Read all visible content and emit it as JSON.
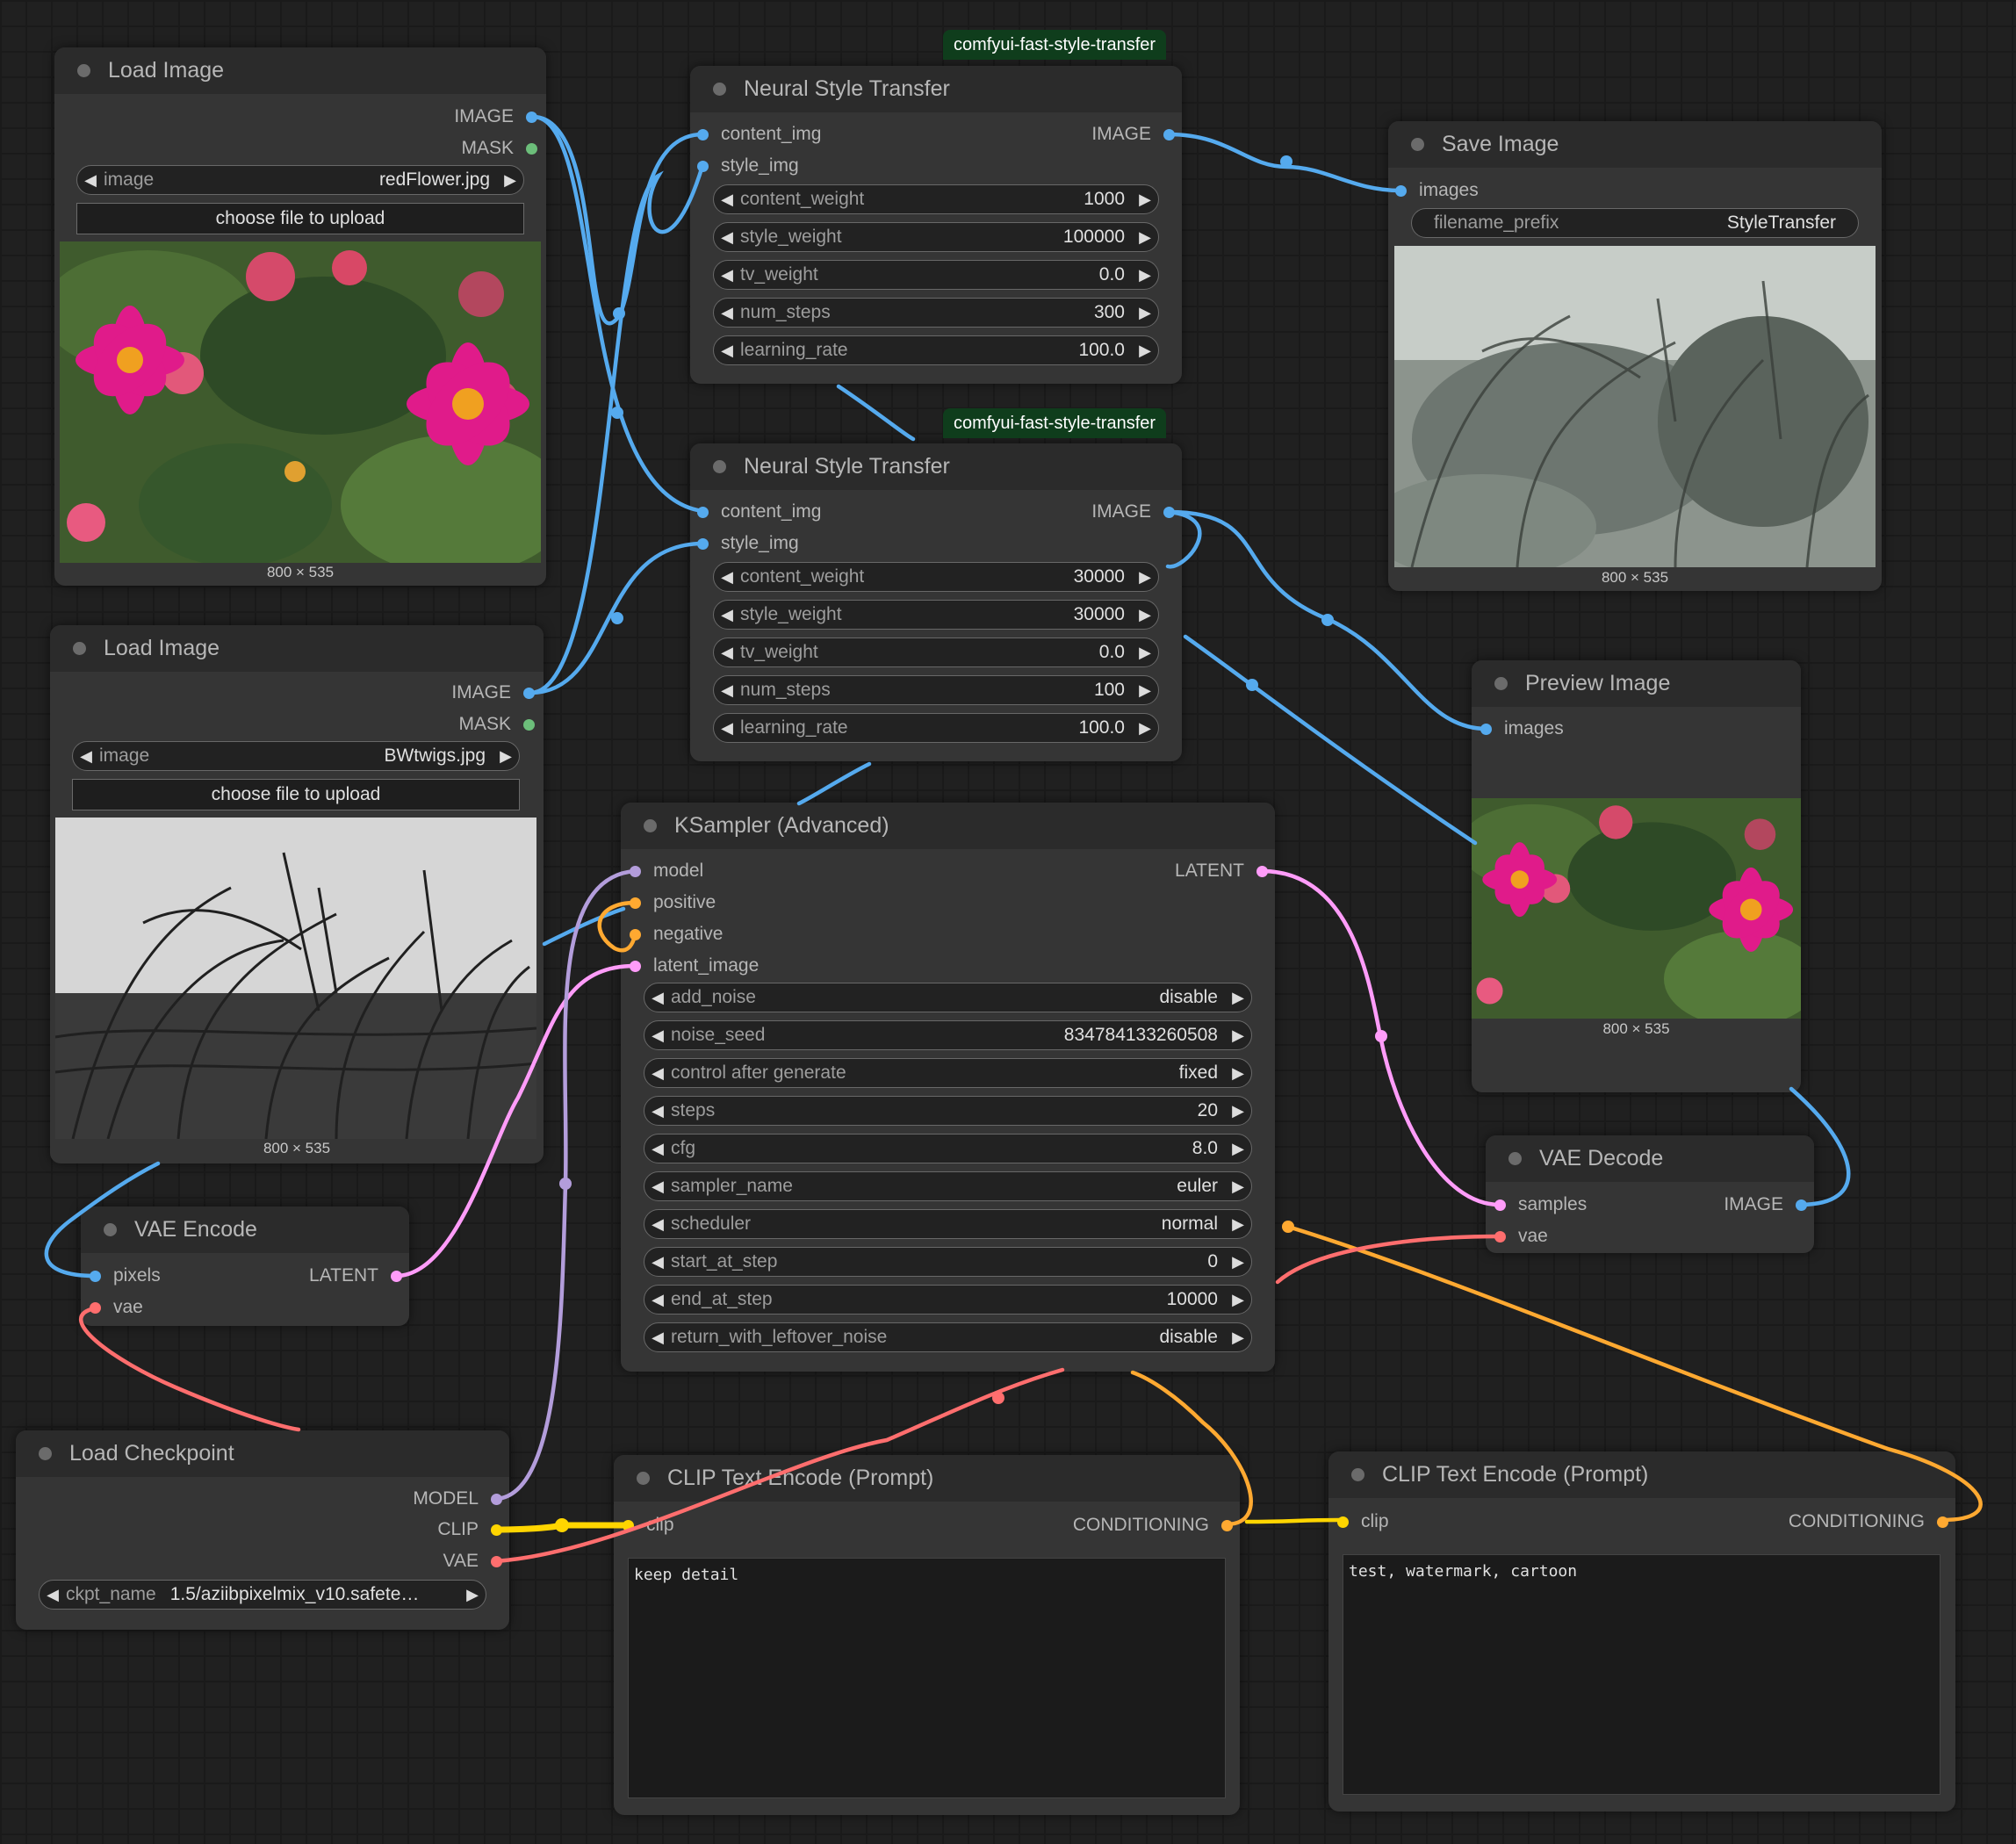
{
  "badges": {
    "nst1": "comfyui-fast-style-transfer",
    "nst2": "comfyui-fast-style-transfer"
  },
  "load_image_1": {
    "title": "Load Image",
    "out_image": "IMAGE",
    "out_mask": "MASK",
    "widget_label": "image",
    "widget_value": "redFlower.jpg",
    "upload_label": "choose file to upload",
    "dims": "800 × 535"
  },
  "load_image_2": {
    "title": "Load Image",
    "out_image": "IMAGE",
    "out_mask": "MASK",
    "widget_label": "image",
    "widget_value": "BWtwigs.jpg",
    "upload_label": "choose file to upload",
    "dims": "800 × 535"
  },
  "nst_1": {
    "title": "Neural Style Transfer",
    "in_content": "content_img",
    "in_style": "style_img",
    "out_image": "IMAGE",
    "widgets": [
      {
        "label": "content_weight",
        "value": "1000"
      },
      {
        "label": "style_weight",
        "value": "100000"
      },
      {
        "label": "tv_weight",
        "value": "0.0"
      },
      {
        "label": "num_steps",
        "value": "300"
      },
      {
        "label": "learning_rate",
        "value": "100.0"
      }
    ]
  },
  "nst_2": {
    "title": "Neural Style Transfer",
    "in_content": "content_img",
    "in_style": "style_img",
    "out_image": "IMAGE",
    "widgets": [
      {
        "label": "content_weight",
        "value": "30000"
      },
      {
        "label": "style_weight",
        "value": "30000"
      },
      {
        "label": "tv_weight",
        "value": "0.0"
      },
      {
        "label": "num_steps",
        "value": "100"
      },
      {
        "label": "learning_rate",
        "value": "100.0"
      }
    ]
  },
  "save_image": {
    "title": "Save Image",
    "in_images": "images",
    "widget_label": "filename_prefix",
    "widget_value": "StyleTransfer",
    "dims": "800 × 535"
  },
  "preview_image": {
    "title": "Preview Image",
    "in_images": "images",
    "dims": "800 × 535"
  },
  "ksampler": {
    "title": "KSampler (Advanced)",
    "in_model": "model",
    "in_positive": "positive",
    "in_negative": "negative",
    "in_latent": "latent_image",
    "out_latent": "LATENT",
    "widgets": [
      {
        "label": "add_noise",
        "value": "disable"
      },
      {
        "label": "noise_seed",
        "value": "834784133260508"
      },
      {
        "label": "control after generate",
        "value": "fixed"
      },
      {
        "label": "steps",
        "value": "20"
      },
      {
        "label": "cfg",
        "value": "8.0"
      },
      {
        "label": "sampler_name",
        "value": "euler"
      },
      {
        "label": "scheduler",
        "value": "normal"
      },
      {
        "label": "start_at_step",
        "value": "0"
      },
      {
        "label": "end_at_step",
        "value": "10000"
      },
      {
        "label": "return_with_leftover_noise",
        "value": "disable"
      }
    ]
  },
  "vae_encode": {
    "title": "VAE Encode",
    "in_pixels": "pixels",
    "in_vae": "vae",
    "out_latent": "LATENT"
  },
  "vae_decode": {
    "title": "VAE Decode",
    "in_samples": "samples",
    "in_vae": "vae",
    "out_image": "IMAGE"
  },
  "load_checkpoint": {
    "title": "Load Checkpoint",
    "out_model": "MODEL",
    "out_clip": "CLIP",
    "out_vae": "VAE",
    "widget_label": "ckpt_name",
    "widget_value": "1.5/aziibpixelmix_v10.safete…"
  },
  "clip_pos": {
    "title": "CLIP Text Encode (Prompt)",
    "in_clip": "clip",
    "out_cond": "CONDITIONING",
    "text": "keep detail"
  },
  "clip_neg": {
    "title": "CLIP Text Encode (Prompt)",
    "in_clip": "clip",
    "out_cond": "CONDITIONING",
    "text": "test, watermark, cartoon"
  },
  "colors": {
    "image": "#55aaee",
    "mask": "#6cbe7a",
    "latent": "#ff9cf9",
    "model": "#b39ddb",
    "clip": "#ffd500",
    "vae": "#ff6e6e",
    "conditioning": "#ffa931"
  }
}
